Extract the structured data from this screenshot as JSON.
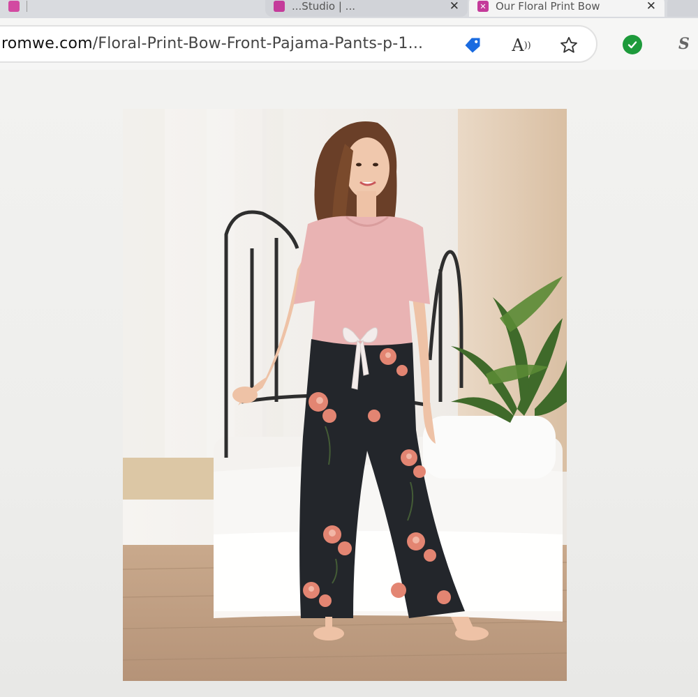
{
  "browser": {
    "tabs": [
      {
        "title": "",
        "state": "inactive"
      },
      {
        "title": "...Studio | ...",
        "state": "inactive"
      },
      {
        "title": "Our Floral Print Bow",
        "state": "active"
      },
      {
        "title": "",
        "state": "inactive"
      }
    ],
    "address_bar": {
      "url_host": "romwe.com",
      "url_path": "/Floral-Print-Bow-Front-Pajama-Pants-p-1..."
    },
    "icons": {
      "tag": "price-tag-icon",
      "read_aloud": "read-aloud-icon",
      "favorite": "star-icon",
      "extension_check": "check-circle-icon",
      "extension_s": "S"
    }
  },
  "product": {
    "image_subject": "woman in pink tee and floral print bow-front pajama pants",
    "colors": {
      "top": "#e9b3b3",
      "pants": "#23262b",
      "flowers": "#e38572"
    }
  }
}
